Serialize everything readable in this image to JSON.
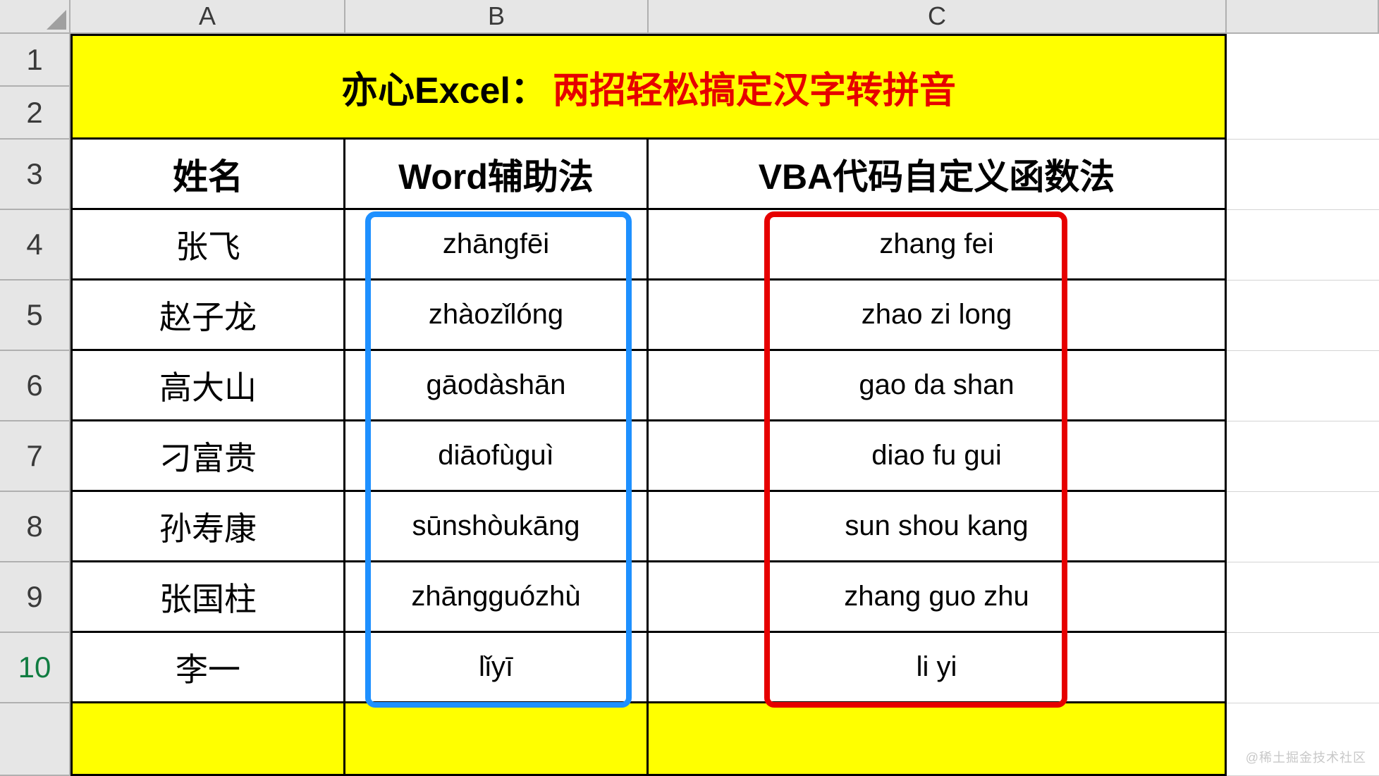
{
  "columns": {
    "A": "A",
    "B": "B",
    "C": "C"
  },
  "row_labels": [
    "1",
    "2",
    "3",
    "4",
    "5",
    "6",
    "7",
    "8",
    "9",
    "10"
  ],
  "title": {
    "part1": "亦心Excel：",
    "part2": "两招轻松搞定汉字转拼音"
  },
  "headers": {
    "A": "姓名",
    "B": "Word辅助法",
    "C": "VBA代码自定义函数法"
  },
  "rows": [
    {
      "name": "张飞",
      "word": "zhāngfēi",
      "vba": "zhang fei"
    },
    {
      "name": "赵子龙",
      "word": "zhàozǐlóng",
      "vba": "zhao zi long"
    },
    {
      "name": "高大山",
      "word": "gāodàshān",
      "vba": "gao da shan"
    },
    {
      "name": "刁富贵",
      "word": "diāofùguì",
      "vba": "diao fu gui"
    },
    {
      "name": "孙寿康",
      "word": "sūnshòukāng",
      "vba": "sun shou kang"
    },
    {
      "name": "张国柱",
      "word": "zhāngguózhù",
      "vba": "zhang guo zhu"
    },
    {
      "name": "李一",
      "word": "lǐyī",
      "vba": "li yi"
    }
  ],
  "watermark": "@稀土掘金技术社区"
}
